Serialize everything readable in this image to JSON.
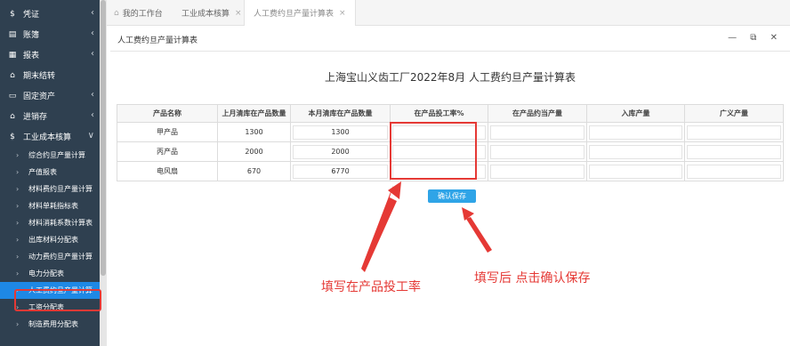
{
  "sidebar": {
    "items": [
      {
        "label": "凭证",
        "icon": "dollar-icon",
        "glyph": "$",
        "chev": "‹"
      },
      {
        "label": "账簿",
        "icon": "book-icon",
        "glyph": "▤",
        "chev": "‹"
      },
      {
        "label": "报表",
        "icon": "report-icon",
        "glyph": "▦",
        "chev": "‹"
      },
      {
        "label": "期末结转",
        "icon": "cycle-icon",
        "glyph": "⌂",
        "chev": ""
      },
      {
        "label": "固定资产",
        "icon": "monitor-icon",
        "glyph": "▭",
        "chev": "‹"
      },
      {
        "label": "进销存",
        "icon": "home-icon",
        "glyph": "⌂",
        "chev": "‹"
      },
      {
        "label": "工业成本核算",
        "icon": "dollar-icon",
        "glyph": "$",
        "chev": "∨"
      }
    ],
    "sub_items": [
      "综合约旦产量计算",
      "产值报表",
      "材料费约旦产量计算",
      "材料单耗指标表",
      "材料消耗系数计算表",
      "出库材料分配表",
      "动力费约旦产量计算",
      "电力分配表",
      "人工费约旦产量计算",
      "工资分配表",
      "制造费用分配表"
    ],
    "active_index": 8
  },
  "tabs": [
    {
      "label": "我的工作台",
      "icon": "home-icon"
    },
    {
      "label": "工业成本核算",
      "close": "×"
    },
    {
      "label": "人工费约旦产量计算表",
      "close": "×"
    }
  ],
  "panel": {
    "title": "人工费约旦产量计算表",
    "controls": "— ⧉ ✕"
  },
  "report": {
    "title": "上海宝山义齿工厂2022年8月 人工费约旦产量计算表",
    "headers": [
      "产品名称",
      "上月清库在产品数量",
      "本月清库在产品数量",
      "在产品投工率%",
      "在产品约当产量",
      "入库产量",
      "广义产量"
    ],
    "rows": [
      {
        "name": "甲产品",
        "last": "1300",
        "current": "1300",
        "rate": "",
        "equiv": "",
        "stock": "",
        "broad": ""
      },
      {
        "name": "丙产品",
        "last": "2000",
        "current": "2000",
        "rate": "",
        "equiv": "",
        "stock": "",
        "broad": ""
      },
      {
        "name": "电风扇",
        "last": "670",
        "current": "6770",
        "rate": "",
        "equiv": "",
        "stock": "",
        "broad": ""
      }
    ],
    "confirm_label": "确认保存"
  },
  "annotations": {
    "left": "填写在产品投工率",
    "right": "填写后  点击确认保存",
    "color": "#e53935"
  }
}
